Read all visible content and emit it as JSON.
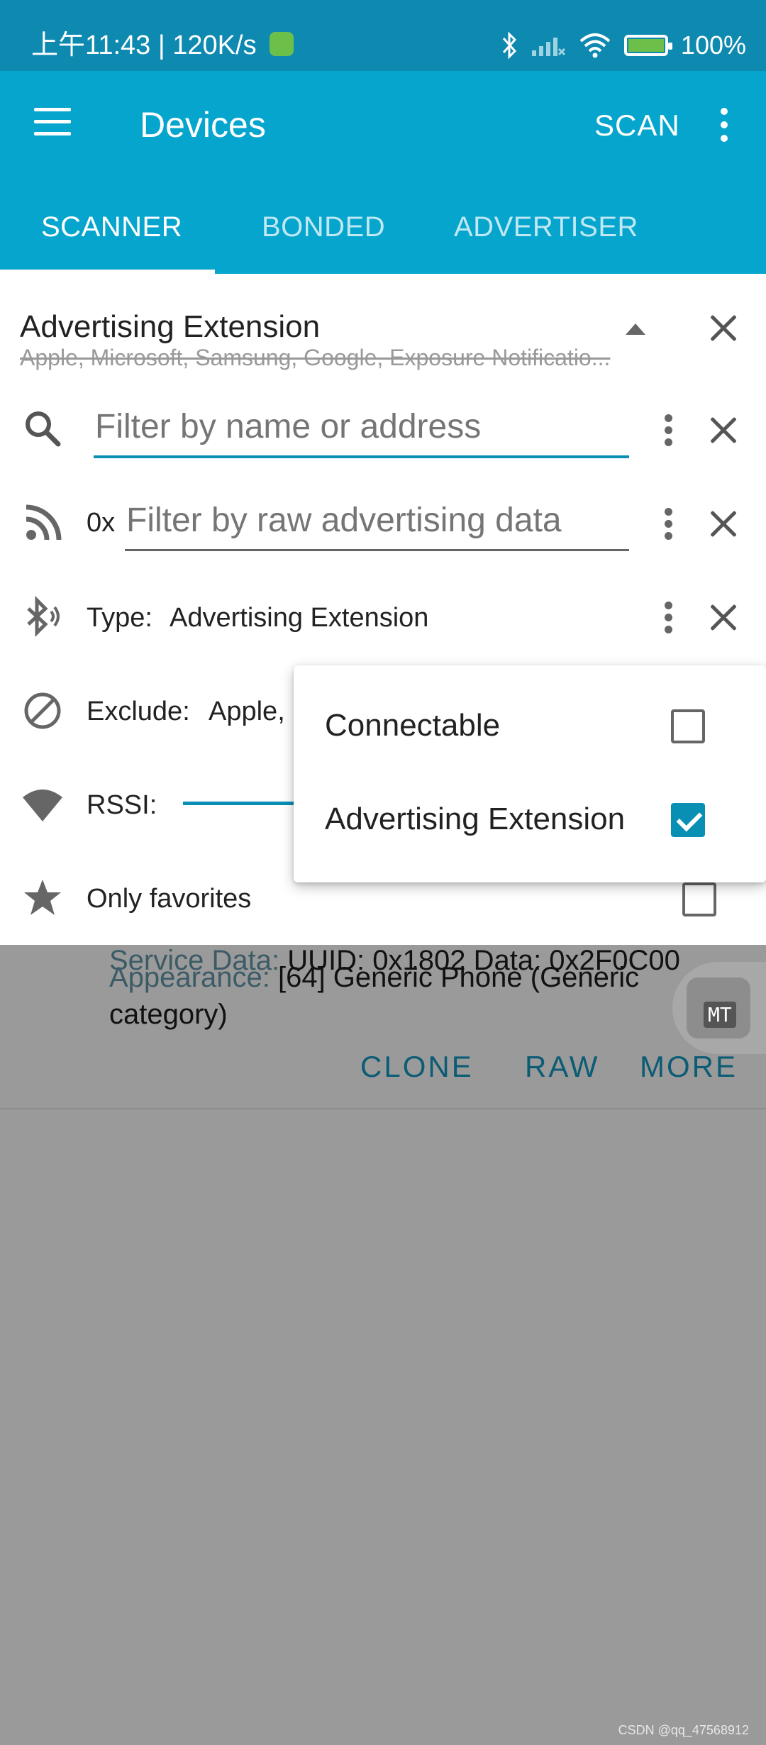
{
  "status_bar": {
    "time": "上午11:43",
    "net_speed": "120K/s",
    "battery": "100%"
  },
  "toolbar": {
    "title": "Devices",
    "scan_label": "SCAN"
  },
  "tabs": [
    {
      "label": "SCANNER",
      "active": true
    },
    {
      "label": "BONDED",
      "active": false
    },
    {
      "label": "ADVERTISER",
      "active": false
    }
  ],
  "filters": {
    "header_title": "Advertising Extension",
    "header_subtitle": "Apple, Microsoft, Samsung, Google, Exposure Notificatio...",
    "name_filter": {
      "placeholder": "Filter by name or address",
      "value": ""
    },
    "raw_filter": {
      "prefix": "0x",
      "placeholder": "Filter by raw advertising data",
      "value": ""
    },
    "type": {
      "label": "Type:",
      "value": "Advertising Extension"
    },
    "exclude": {
      "label": "Exclude:",
      "value": "Apple,"
    },
    "rssi": {
      "label": "RSSI:"
    },
    "favorites": {
      "label": "Only favorites",
      "checked": false
    }
  },
  "type_dropdown": {
    "options": [
      {
        "label": "Connectable",
        "checked": false
      },
      {
        "label": "Advertising Extension",
        "checked": true
      }
    ]
  },
  "device_card": {
    "service_data_label": "Service Data:",
    "service_data_value": "UUID: 0x1802 Data: 0x2F0C00",
    "appearance_label": "Appearance:",
    "appearance_value_line1": "[64] Generic Phone (Generic",
    "appearance_value_line2": "category)",
    "actions": [
      "CLONE",
      "RAW",
      "MORE"
    ]
  },
  "floating_button": {
    "label": "MT"
  },
  "watermark": "CSDN @qq_47568912",
  "colors": {
    "primary": "#06a5cd",
    "status_bar": "#0e89b0",
    "accent": "#0a8fb4",
    "scrim": "#9a9a9a"
  }
}
